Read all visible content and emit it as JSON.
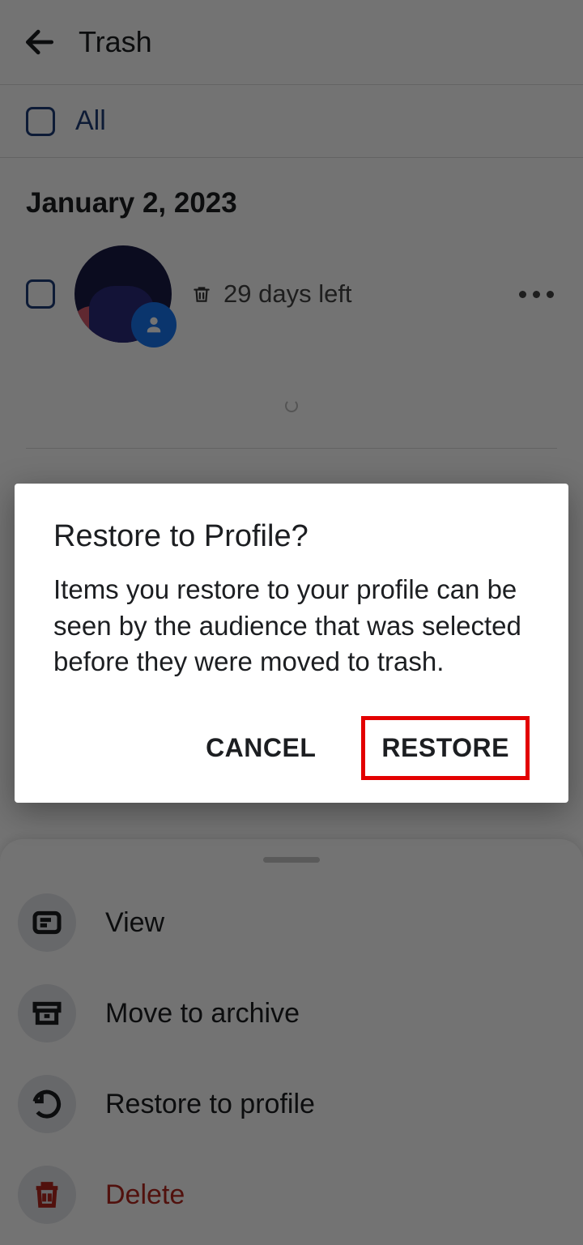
{
  "header": {
    "title": "Trash"
  },
  "select_all": {
    "label": "All"
  },
  "group": {
    "date": "January 2, 2023",
    "item": {
      "days_left": "29 days left"
    }
  },
  "sheet": {
    "items": [
      {
        "label": "View"
      },
      {
        "label": "Move to archive"
      },
      {
        "label": "Restore to profile"
      },
      {
        "label": "Delete"
      }
    ]
  },
  "dialog": {
    "title": "Restore to Profile?",
    "body": "Items you restore to your profile can be seen by the audience that was selected before they were moved to trash.",
    "cancel": "CANCEL",
    "confirm": "RESTORE"
  }
}
